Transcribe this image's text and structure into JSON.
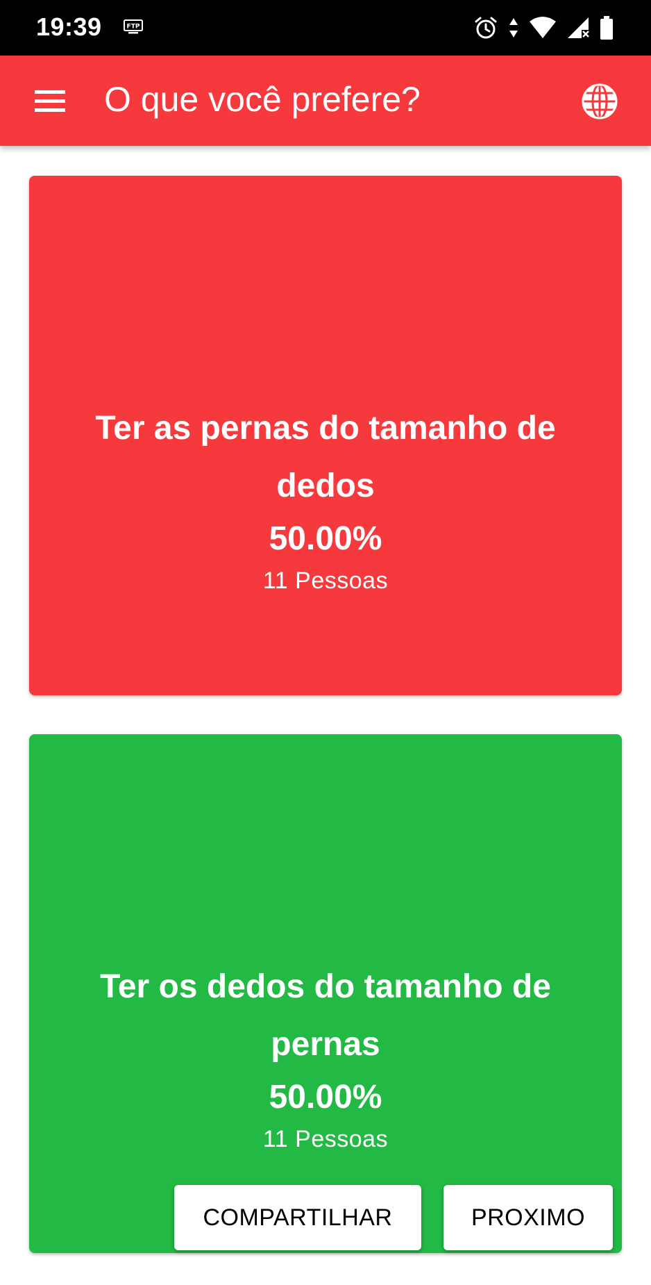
{
  "status_bar": {
    "time": "19:39",
    "icons": [
      "ftp-icon",
      "alarm-icon",
      "data-arrows-icon",
      "wifi-icon",
      "signal-icon",
      "battery-icon"
    ]
  },
  "app_bar": {
    "title": "O que você prefere?",
    "menu_icon": "menu-icon",
    "language_icon": "globe-icon",
    "color": "#f6393c"
  },
  "options": [
    {
      "text": "Ter as pernas do tamanho de dedos",
      "percent": "50.00%",
      "count": "11 Pessoas",
      "color": "#f6393c"
    },
    {
      "text": "Ter os dedos do tamanho de pernas",
      "percent": "50.00%",
      "count": "11 Pessoas",
      "color": "#22ba45"
    }
  ],
  "actions": {
    "share_label": "COMPARTILHAR",
    "next_label": "PROXIMO"
  }
}
